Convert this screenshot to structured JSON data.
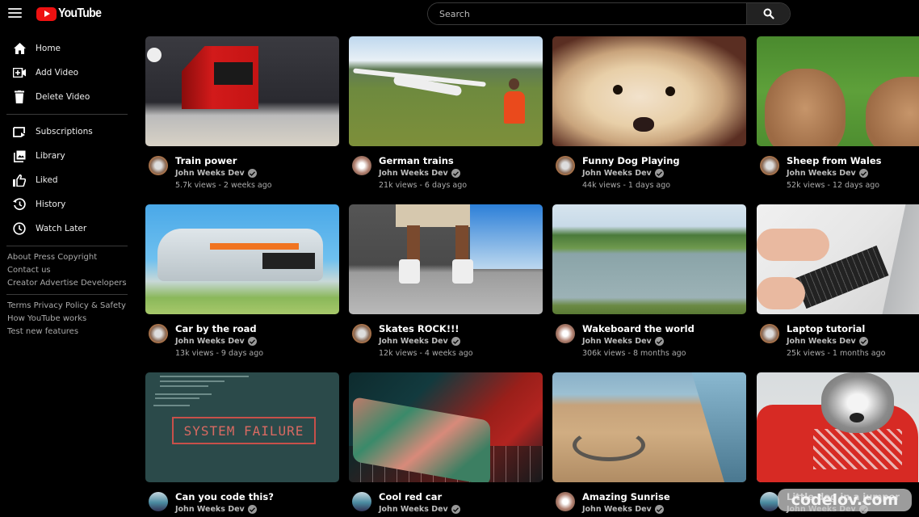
{
  "header": {
    "app_name": "YouTube",
    "search_placeholder": "Search",
    "search_value": "",
    "brand_color": "#ee1111"
  },
  "sidebar": {
    "primary": [
      {
        "label": "Home",
        "icon": "home-icon"
      },
      {
        "label": "Add Video",
        "icon": "add-video-icon"
      },
      {
        "label": "Delete Video",
        "icon": "trash-icon"
      }
    ],
    "secondary": [
      {
        "label": "Subscriptions",
        "icon": "subscriptions-icon"
      },
      {
        "label": "Library",
        "icon": "library-icon"
      },
      {
        "label": "Liked",
        "icon": "thumbs-up-icon"
      },
      {
        "label": "History",
        "icon": "history-icon"
      },
      {
        "label": "Watch Later",
        "icon": "clock-icon"
      }
    ],
    "footer_group_1": [
      [
        "About",
        "Press",
        "Copyright"
      ],
      [
        "Contact us"
      ],
      [
        "Creator",
        "Advertise",
        "Developers"
      ]
    ],
    "footer_group_2": [
      [
        "Terms",
        "Privacy",
        "Policy & Safety"
      ],
      [
        "How YouTube works"
      ],
      [
        "Test new features"
      ]
    ]
  },
  "videos": [
    {
      "title": "Train power",
      "channel": "John Weeks Dev",
      "views": "5.7k views",
      "age": "2 weeks ago",
      "stats": "5.7k views - 2 weeks ago"
    },
    {
      "title": "German trains",
      "channel": "John Weeks Dev",
      "views": "21k views",
      "age": "6 days ago",
      "stats": "21k views - 6 days ago"
    },
    {
      "title": "Funny Dog Playing",
      "channel": "John Weeks Dev",
      "views": "44k views",
      "age": "1 days ago",
      "stats": "44k views - 1 days ago"
    },
    {
      "title": "Sheep from Wales",
      "channel": "John Weeks Dev",
      "views": "52k views",
      "age": "12 days ago",
      "stats": "52k views - 12 days ago"
    },
    {
      "title": "Car by the road",
      "channel": "John Weeks Dev",
      "views": "13k views",
      "age": "9 days ago",
      "stats": "13k views - 9 days ago"
    },
    {
      "title": "Skates ROCK!!!",
      "channel": "John Weeks Dev",
      "views": "12k views",
      "age": "4 weeks ago",
      "stats": "12k views - 4 weeks ago"
    },
    {
      "title": "Wakeboard the world",
      "channel": "John Weeks Dev",
      "views": "306k views",
      "age": "8 months ago",
      "stats": "306k views - 8 months ago"
    },
    {
      "title": "Laptop tutorial",
      "channel": "John Weeks Dev",
      "views": "25k views",
      "age": "1 months ago",
      "stats": "25k views - 1 months ago"
    },
    {
      "title": "Can you code this?",
      "channel": "John Weeks Dev",
      "thumb_text": "SYSTEM FAILURE"
    },
    {
      "title": "Cool red car",
      "channel": "John Weeks Dev"
    },
    {
      "title": "Amazing Sunrise",
      "channel": "John Weeks Dev"
    },
    {
      "title": "Little dog in a jumper",
      "channel": "John Weeks Dev"
    }
  ],
  "watermark": "codelov.com"
}
